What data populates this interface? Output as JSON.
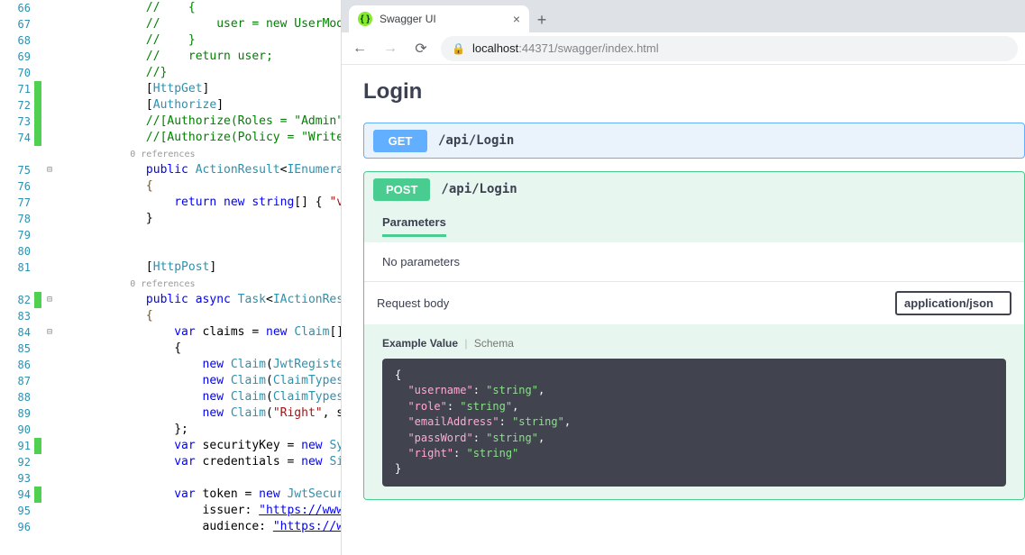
{
  "editor": {
    "lines": [
      {
        "n": 66,
        "marker": "",
        "fold": "",
        "spans": [
          {
            "cls": "tk-com",
            "t": "//    {"
          }
        ]
      },
      {
        "n": 67,
        "marker": "",
        "fold": "",
        "spans": [
          {
            "cls": "tk-com",
            "t": "//        user = new UserMode"
          }
        ]
      },
      {
        "n": 68,
        "marker": "",
        "fold": "",
        "spans": [
          {
            "cls": "tk-com",
            "t": "//    }"
          }
        ]
      },
      {
        "n": 69,
        "marker": "",
        "fold": "",
        "spans": [
          {
            "cls": "tk-com",
            "t": "//    return user;"
          }
        ]
      },
      {
        "n": 70,
        "marker": "",
        "fold": "",
        "spans": [
          {
            "cls": "tk-com",
            "t": "//}"
          }
        ]
      },
      {
        "n": 71,
        "marker": "green",
        "fold": "",
        "spans": [
          {
            "cls": "tk-punc",
            "t": "["
          },
          {
            "cls": "tk-attr",
            "t": "HttpGet"
          },
          {
            "cls": "tk-punc",
            "t": "]"
          }
        ]
      },
      {
        "n": 72,
        "marker": "green",
        "fold": "",
        "spans": [
          {
            "cls": "tk-punc",
            "t": "["
          },
          {
            "cls": "tk-attr",
            "t": "Authorize"
          },
          {
            "cls": "tk-punc",
            "t": "]"
          }
        ]
      },
      {
        "n": 73,
        "marker": "green",
        "fold": "",
        "spans": [
          {
            "cls": "tk-com",
            "t": "//[Authorize(Roles = \"Admin\")]"
          }
        ]
      },
      {
        "n": 74,
        "marker": "green",
        "fold": "",
        "spans": [
          {
            "cls": "tk-com",
            "t": "//[Authorize(Policy = \"Write\""
          }
        ]
      },
      {
        "n": 0,
        "marker": "",
        "fold": "",
        "refs": "0 references"
      },
      {
        "n": 75,
        "marker": "",
        "fold": "⊟",
        "spans": [
          {
            "cls": "tk-kw",
            "t": "public "
          },
          {
            "cls": "tk-type",
            "t": "ActionResult"
          },
          {
            "cls": "tk-punc",
            "t": "<"
          },
          {
            "cls": "tk-type",
            "t": "IEnumerab"
          }
        ]
      },
      {
        "n": 76,
        "marker": "",
        "fold": "",
        "spans": [
          {
            "cls": "tk-purple",
            "t": "{"
          }
        ]
      },
      {
        "n": 77,
        "marker": "",
        "fold": "",
        "spans": [
          {
            "cls": "tk-ident",
            "t": "    "
          },
          {
            "cls": "tk-kw",
            "t": "return new string"
          },
          {
            "cls": "tk-punc",
            "t": "[] { "
          },
          {
            "cls": "tk-str",
            "t": "\"va"
          }
        ]
      },
      {
        "n": 78,
        "marker": "",
        "fold": "",
        "spans": [
          {
            "cls": "tk-punc",
            "t": "}"
          }
        ]
      },
      {
        "n": 79,
        "marker": "",
        "fold": "",
        "spans": []
      },
      {
        "n": 80,
        "marker": "",
        "fold": "",
        "spans": []
      },
      {
        "n": 81,
        "marker": "",
        "fold": "",
        "spans": [
          {
            "cls": "tk-punc",
            "t": "["
          },
          {
            "cls": "tk-attr",
            "t": "HttpPost"
          },
          {
            "cls": "tk-punc",
            "t": "]"
          }
        ]
      },
      {
        "n": 0,
        "marker": "",
        "fold": "",
        "refs": "0 references"
      },
      {
        "n": 82,
        "marker": "green",
        "fold": "⊟",
        "spans": [
          {
            "cls": "tk-kw",
            "t": "public async "
          },
          {
            "cls": "tk-type",
            "t": "Task"
          },
          {
            "cls": "tk-punc",
            "t": "<"
          },
          {
            "cls": "tk-type",
            "t": "IActionResu"
          }
        ]
      },
      {
        "n": 83,
        "marker": "",
        "fold": "",
        "spans": [
          {
            "cls": "tk-purple",
            "t": "{"
          }
        ]
      },
      {
        "n": 84,
        "marker": "",
        "fold": "⊟",
        "spans": [
          {
            "cls": "tk-ident",
            "t": "    "
          },
          {
            "cls": "tk-kw",
            "t": "var "
          },
          {
            "cls": "tk-ident",
            "t": "claims = "
          },
          {
            "cls": "tk-kw",
            "t": "new "
          },
          {
            "cls": "tk-type",
            "t": "Claim"
          },
          {
            "cls": "tk-punc",
            "t": "[]"
          }
        ]
      },
      {
        "n": 85,
        "marker": "",
        "fold": "",
        "spans": [
          {
            "cls": "tk-ident",
            "t": "    {"
          }
        ]
      },
      {
        "n": 86,
        "marker": "",
        "fold": "",
        "spans": [
          {
            "cls": "tk-ident",
            "t": "        "
          },
          {
            "cls": "tk-kw",
            "t": "new "
          },
          {
            "cls": "tk-type",
            "t": "Claim"
          },
          {
            "cls": "tk-punc",
            "t": "("
          },
          {
            "cls": "tk-type",
            "t": "JwtRegistere"
          }
        ]
      },
      {
        "n": 87,
        "marker": "",
        "fold": "",
        "spans": [
          {
            "cls": "tk-ident",
            "t": "        "
          },
          {
            "cls": "tk-kw",
            "t": "new "
          },
          {
            "cls": "tk-type",
            "t": "Claim"
          },
          {
            "cls": "tk-punc",
            "t": "("
          },
          {
            "cls": "tk-type",
            "t": "ClaimTypes"
          },
          {
            "cls": "tk-punc",
            "t": ".R"
          }
        ]
      },
      {
        "n": 88,
        "marker": "",
        "fold": "",
        "spans": [
          {
            "cls": "tk-ident",
            "t": "        "
          },
          {
            "cls": "tk-kw",
            "t": "new "
          },
          {
            "cls": "tk-type",
            "t": "Claim"
          },
          {
            "cls": "tk-punc",
            "t": "("
          },
          {
            "cls": "tk-type",
            "t": "ClaimTypes"
          },
          {
            "cls": "tk-punc",
            "t": ".N"
          }
        ]
      },
      {
        "n": 89,
        "marker": "",
        "fold": "",
        "spans": [
          {
            "cls": "tk-ident",
            "t": "        "
          },
          {
            "cls": "tk-kw",
            "t": "new "
          },
          {
            "cls": "tk-type",
            "t": "Claim"
          },
          {
            "cls": "tk-punc",
            "t": "("
          },
          {
            "cls": "tk-str",
            "t": "\"Right\""
          },
          {
            "cls": "tk-punc",
            "t": ", som"
          }
        ]
      },
      {
        "n": 90,
        "marker": "",
        "fold": "",
        "spans": [
          {
            "cls": "tk-ident",
            "t": "    };"
          }
        ]
      },
      {
        "n": 91,
        "marker": "green",
        "fold": "",
        "spans": [
          {
            "cls": "tk-ident",
            "t": "    "
          },
          {
            "cls": "tk-kw",
            "t": "var "
          },
          {
            "cls": "tk-ident",
            "t": "securityKey = "
          },
          {
            "cls": "tk-kw",
            "t": "new "
          },
          {
            "cls": "tk-type",
            "t": "Sym"
          }
        ]
      },
      {
        "n": 92,
        "marker": "",
        "fold": "",
        "spans": [
          {
            "cls": "tk-ident",
            "t": "    "
          },
          {
            "cls": "tk-kw",
            "t": "var "
          },
          {
            "cls": "tk-ident",
            "t": "credentials = "
          },
          {
            "cls": "tk-kw",
            "t": "new "
          },
          {
            "cls": "tk-type",
            "t": "Sig"
          }
        ]
      },
      {
        "n": 93,
        "marker": "",
        "fold": "",
        "spans": []
      },
      {
        "n": 94,
        "marker": "green",
        "fold": "",
        "spans": [
          {
            "cls": "tk-ident",
            "t": "    "
          },
          {
            "cls": "tk-kw",
            "t": "var "
          },
          {
            "cls": "tk-ident",
            "t": "token = "
          },
          {
            "cls": "tk-kw",
            "t": "new "
          },
          {
            "cls": "tk-type",
            "t": "JwtSecurit"
          }
        ]
      },
      {
        "n": 95,
        "marker": "",
        "fold": "",
        "spans": [
          {
            "cls": "tk-ident",
            "t": "        issuer: "
          },
          {
            "cls": "tk-link",
            "t": "\"https://www.yog"
          }
        ]
      },
      {
        "n": 96,
        "marker": "",
        "fold": "",
        "spans": [
          {
            "cls": "tk-ident",
            "t": "        audience: "
          },
          {
            "cls": "tk-link",
            "t": "\"https://www.y"
          }
        ]
      }
    ]
  },
  "browser": {
    "tab_title": "Swagger UI",
    "url_host": "localhost",
    "url_port_path": ":44371/swagger/index.html"
  },
  "swagger": {
    "section_title": "Login",
    "endpoints": [
      {
        "method": "GET",
        "path": "/api/Login"
      },
      {
        "method": "POST",
        "path": "/api/Login"
      }
    ],
    "parameters_label": "Parameters",
    "no_params_text": "No parameters",
    "request_body_label": "Request body",
    "mime": "application/json",
    "example_label": "Example Value",
    "schema_label": "Schema",
    "example_json": [
      {
        "k": "username",
        "v": "string"
      },
      {
        "k": "role",
        "v": "string"
      },
      {
        "k": "emailAddress",
        "v": "string"
      },
      {
        "k": "passWord",
        "v": "string"
      },
      {
        "k": "right",
        "v": "string"
      }
    ]
  }
}
